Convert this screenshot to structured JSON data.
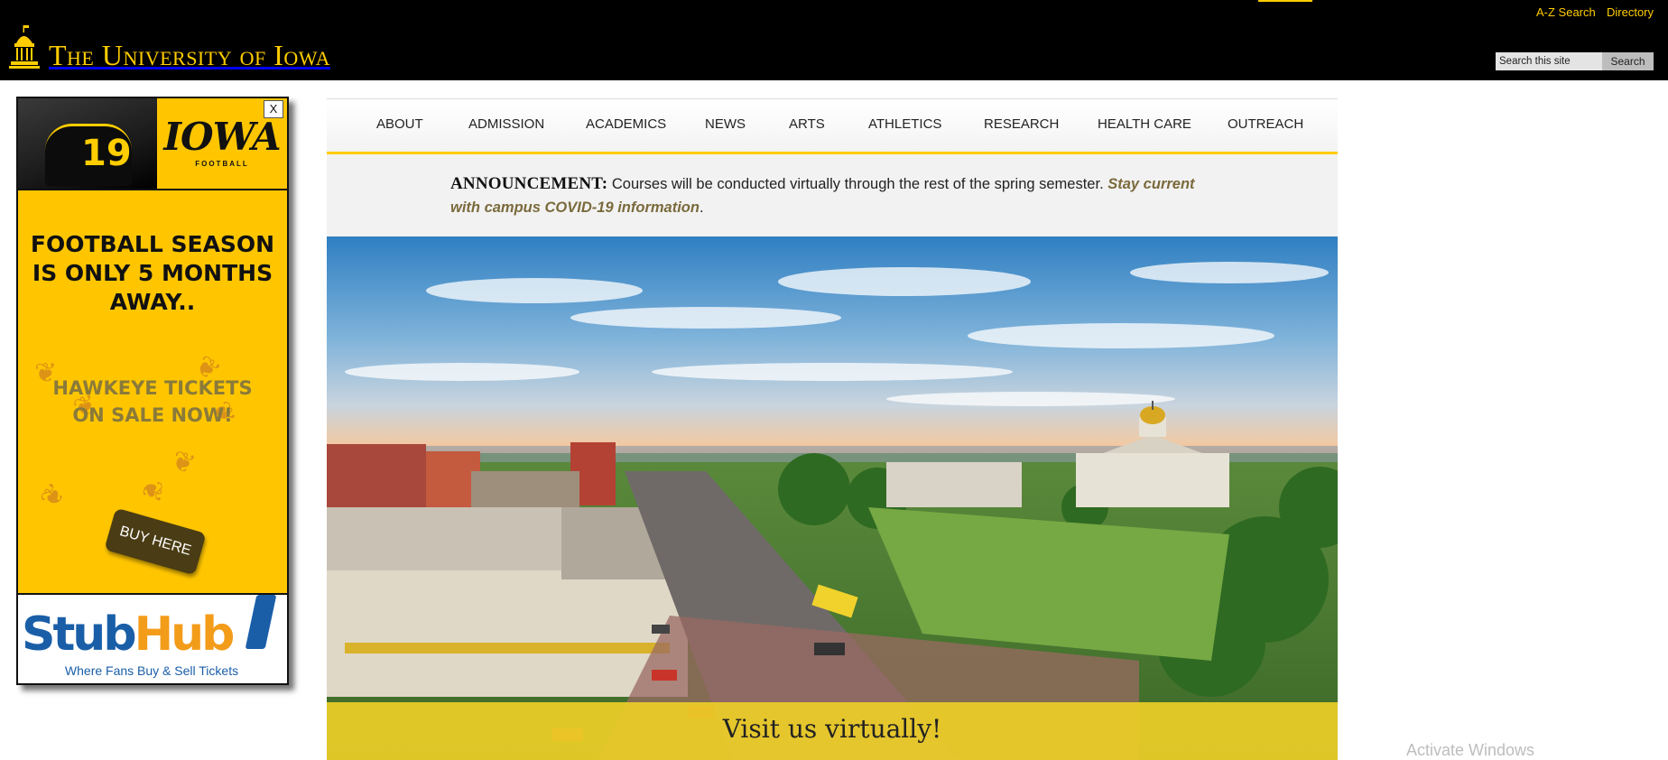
{
  "header": {
    "logo_text": "The University of Iowa",
    "utility_links": [
      "A-Z Search",
      "Directory"
    ],
    "search": {
      "placeholder": "Search this site",
      "value": "Search this site",
      "button_label": "Search"
    }
  },
  "ad": {
    "close_label": "X",
    "jersey_number": "19",
    "team_word": "IOWA",
    "team_sub": "FOOTBALL",
    "headline": "FOOTBALL SEASON IS ONLY 5 MONTHS AWAY..",
    "subhead": "HAWKEYE TICKETS ON SALE NOW!",
    "button_label": "BUY HERE",
    "stubhub_part1": "Stub",
    "stubhub_part2": "Hub",
    "stubhub_tagline": "Where Fans Buy & Sell Tickets"
  },
  "nav": {
    "items": [
      "ABOUT",
      "ADMISSION",
      "ACADEMICS",
      "NEWS",
      "ARTS",
      "ATHLETICS",
      "RESEARCH",
      "HEALTH CARE",
      "OUTREACH"
    ]
  },
  "announcement": {
    "label": "ANNOUNCEMENT:",
    "text": " Courses will be conducted virtually through the rest of the spring semester. ",
    "link_text": "Stay current with campus COVID-19 information",
    "trailing": "."
  },
  "hero": {
    "banner_text": "Visit us virtually!"
  },
  "watermark": "Activate Windows",
  "colors": {
    "gold": "#ffcd00",
    "black": "#000000",
    "link_brown": "#7a6a3c",
    "ad_yellow": "#ffc600"
  }
}
